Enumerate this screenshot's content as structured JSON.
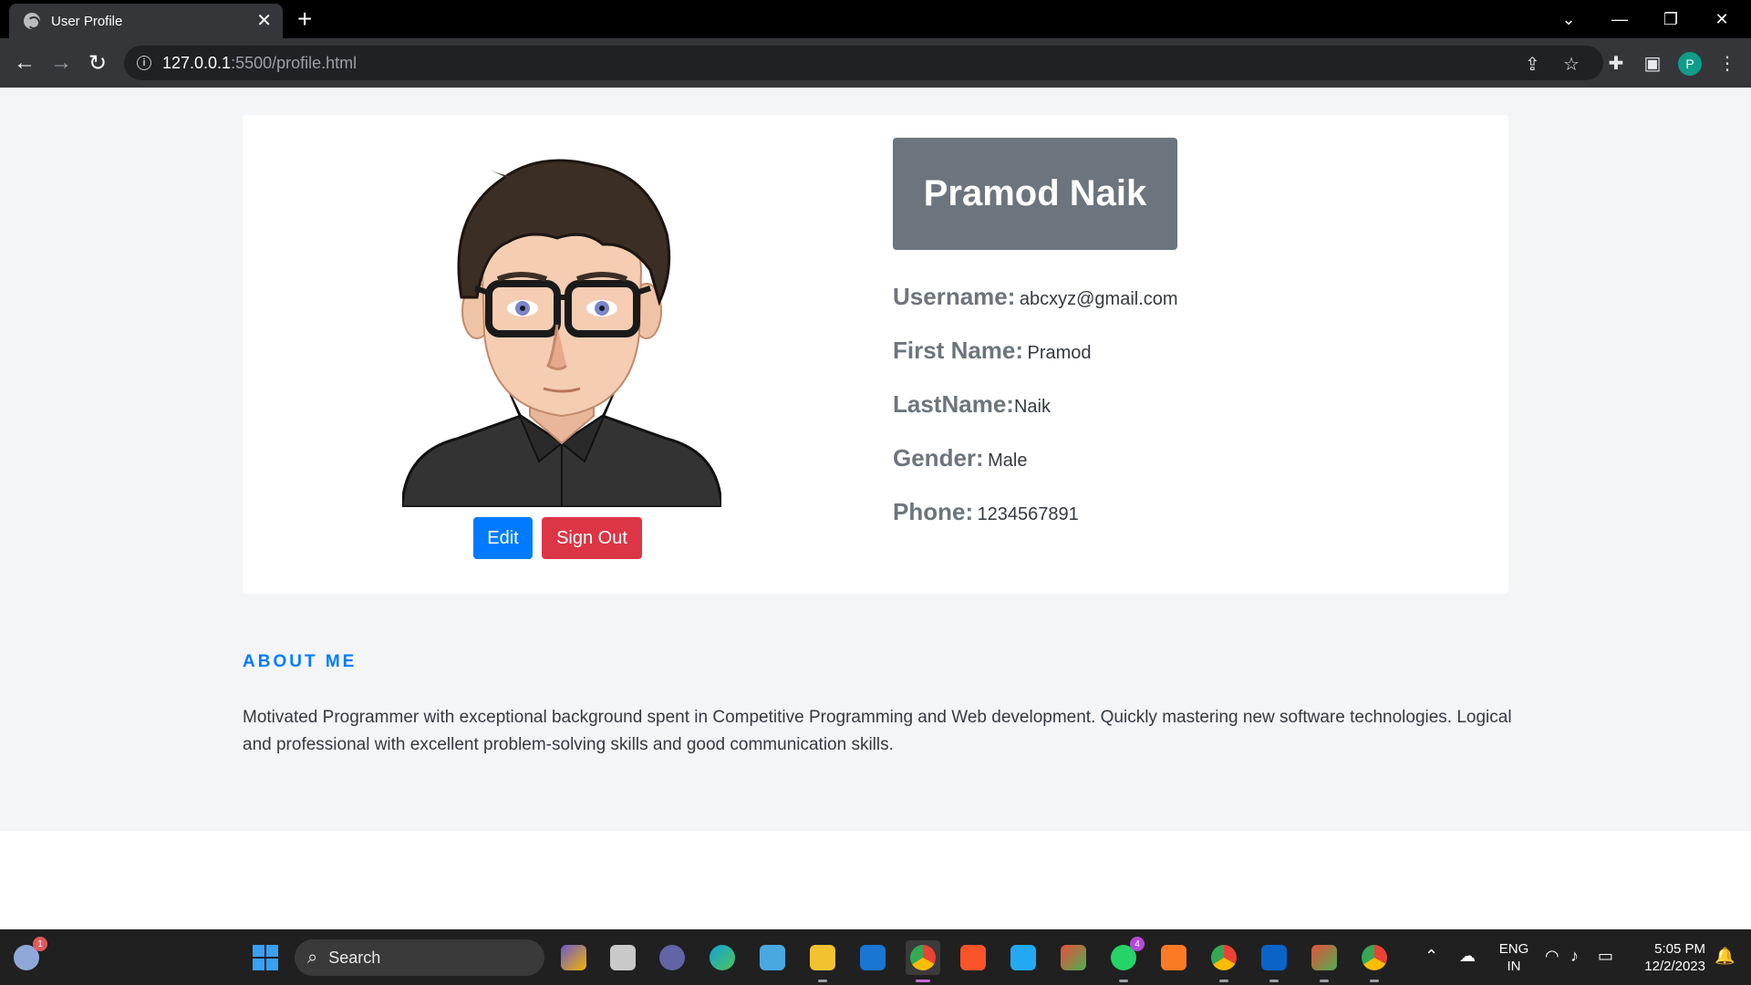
{
  "browser": {
    "tab_title": "User Profile",
    "tab_close": "✕",
    "new_tab": "+",
    "url_host": "127.0.0.1",
    "url_rest": ":5500/profile.html",
    "profile_initial": "P"
  },
  "profile": {
    "name": "Pramod Naik",
    "fields": [
      {
        "label": "Username:",
        "value": "abcxyz@gmail.com"
      },
      {
        "label": "First Name:",
        "value": "Pramod"
      },
      {
        "label": "LastName:",
        "value": "Naik"
      },
      {
        "label": "Gender:",
        "value": "Male"
      },
      {
        "label": "Phone:",
        "value": "1234567891"
      }
    ],
    "edit_label": "Edit",
    "signout_label": "Sign Out"
  },
  "about": {
    "heading": "ABOUT ME",
    "text": "Motivated Programmer with exceptional background spent in Competitive Programming and Web development. Quickly mastering new software technologies. Logical and professional with excellent problem-solving skills and good communication skills."
  },
  "taskbar": {
    "search_label": "Search",
    "weather_badge": "1",
    "whatsapp_badge": "4",
    "language": "ENG",
    "region": "IN",
    "time": "5:05 PM",
    "date": "12/2/2023"
  },
  "colors": {
    "primary": "#007bff",
    "danger": "#dc3545",
    "secondary": "#6c757d"
  }
}
